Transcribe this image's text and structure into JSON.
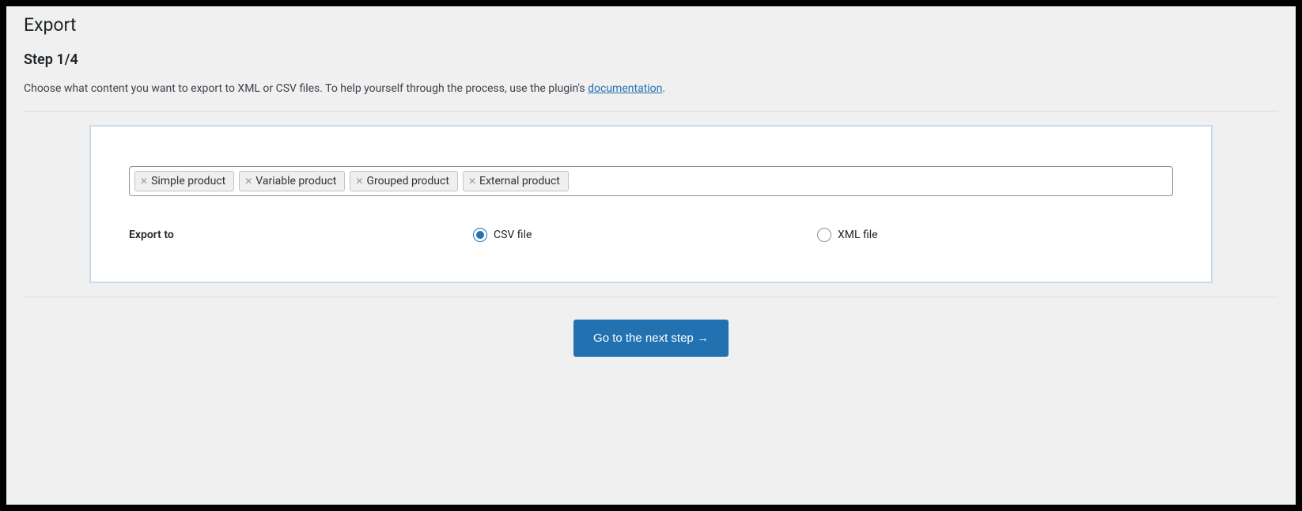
{
  "page": {
    "title": "Export",
    "step_label": "Step 1/4",
    "description_prefix": "Choose what content you want to export to XML or CSV files. To help yourself through the process, use the plugin's ",
    "documentation_link": "documentation",
    "description_suffix": "."
  },
  "tags": [
    "Simple product",
    "Variable product",
    "Grouped product",
    "External product"
  ],
  "export_to": {
    "label": "Export to",
    "options": {
      "csv": "CSV file",
      "xml": "XML file"
    },
    "selected": "csv"
  },
  "button": {
    "next_label": "Go to the next step →"
  }
}
